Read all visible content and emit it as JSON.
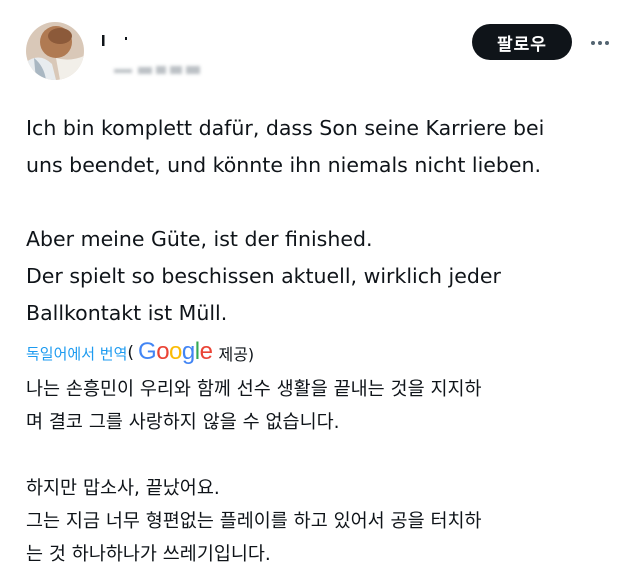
{
  "header": {
    "follow_label": "팔로우"
  },
  "tweet": {
    "lines": [
      "Ich bin komplett dafür, dass Son seine Karriere bei",
      "uns beendet, und könnte ihn niemals nicht lieben.",
      "Aber meine Güte, ist der finished.",
      "Der spielt so beschissen aktuell, wirklich jeder",
      "Ballkontakt ist Müll."
    ]
  },
  "translation": {
    "link_label": "독일어에서 번역",
    "open_paren": "(",
    "provider": "Google",
    "provided_label": "제공)",
    "provider_colors": [
      "#4285F4",
      "#EA4335",
      "#FBBC05",
      "#4285F4",
      "#34A853",
      "#EA4335"
    ],
    "lines": [
      "나는 손흥민이 우리와 함께 선수 생활을 끝내는 것을 지지하",
      "며 결코 그를 사랑하지 않을 수 없습니다.",
      "하지만 맙소사, 끝났어요.",
      "그는 지금 너무 형편없는 플레이를 하고 있어서 공을 터치하",
      "는 것 하나하나가 쓰레기입니다."
    ]
  }
}
